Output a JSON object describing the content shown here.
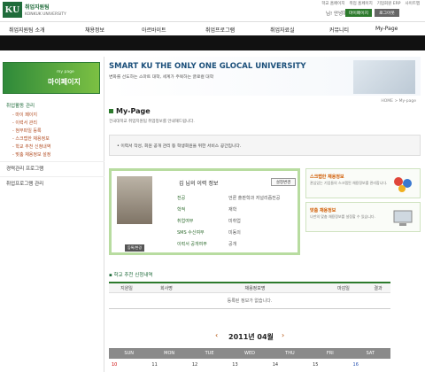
{
  "brand": {
    "logo": "KU",
    "name": "취업지원팀",
    "sub": "KONKUK UNIVERSITY"
  },
  "toplinks": [
    "학교 홈페이지",
    "취업 홈페이지",
    "기업회원 ERP",
    "사이트맵"
  ],
  "user": {
    "greeting": "님! 안녕하세요.",
    "mypage_label": "마이페이지",
    "logout_label": "로그아웃"
  },
  "nav": [
    "취업지원팀 소개",
    "채용정보",
    "아르바이트",
    "취업프로그램",
    "취업자료실",
    "커뮤니티",
    "My-Page"
  ],
  "sidebar": {
    "head_small": "my page",
    "head_title": "마이페이지",
    "section1": "취업활동 관리",
    "items": [
      "마이 페이지",
      "이력서 관리",
      "첨부파일 등록",
      "스크랩한 채용정보",
      "학교 추천 신청내역",
      "맞춤 채용정보 설정"
    ],
    "section2": "경력관리 프로그램",
    "section3": "취업프로그램 관리"
  },
  "banner": {
    "title": "SMART KU THE ONLY ONE GLOCAL UNIVERSITY",
    "subtitle": "변화를 선도하는 스마트 대학, 세계가 주목하는 글로컬 대학"
  },
  "breadcrumb": "HOME > My-page",
  "page": {
    "title": "My-Page",
    "desc": "건국대학교 취업지원팀 취업정보를 안내해드립니다."
  },
  "notice": "• 이력서 작성, 회원 공개 관리 등 학생회원을 위한 서비스 공간입니다.",
  "profile": {
    "name": "김 님의 이력 정보",
    "edit_label": "설정변경",
    "photo_label": "등록/변경",
    "fields": [
      {
        "label": "전공",
        "value": "언론 출판학과 저널리즘전공"
      },
      {
        "label": "학적",
        "value": "재학"
      },
      {
        "label": "취업여부",
        "value": "미취업"
      },
      {
        "label": "SMS 수신여부",
        "value": "미동의"
      },
      {
        "label": "이력서 공개여부",
        "value": "공개"
      }
    ]
  },
  "right_boxes": [
    {
      "title": "스크랩한 채용정보",
      "desc": "관심있는 기업들의 스크랩된 채용정보를 관리합니다."
    },
    {
      "title": "맞춤 채용정보",
      "desc": "나만의 맞춤 채용정보를 설정할 수 있습니다."
    }
  ],
  "recommend": {
    "section_title": "학교 추천 신청내역",
    "columns": [
      "지원일",
      "회사명",
      "채용정보명",
      "마감일",
      "결과"
    ],
    "empty": "등록된 정보가 없습니다."
  },
  "calendar": {
    "month": "2011년 04월",
    "prev": "‹",
    "next": "›",
    "days": [
      "SUN",
      "MON",
      "TUE",
      "WED",
      "THU",
      "FRI",
      "SAT"
    ],
    "first_row": [
      "10",
      "11",
      "12",
      "13",
      "14",
      "15",
      "16"
    ]
  },
  "colors": {
    "brand_green": "#1f6b3a",
    "accent_orange": "#d05a00"
  }
}
